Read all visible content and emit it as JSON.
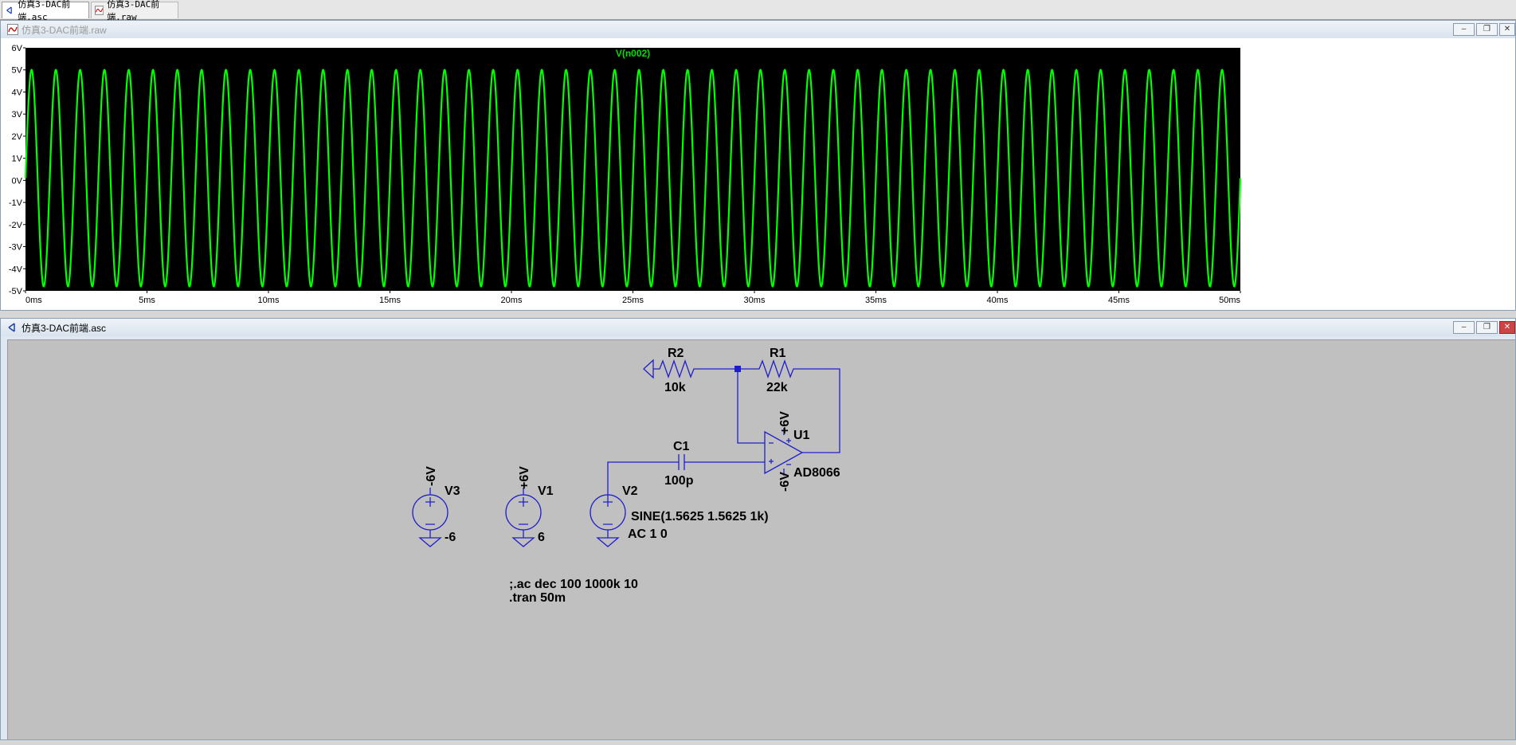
{
  "tabs": [
    {
      "label": "仿真3-DAC前端.asc",
      "icon": "schematic-icon"
    },
    {
      "label": "仿真3-DAC前端.raw",
      "icon": "waveform-icon"
    }
  ],
  "waveform_window": {
    "title": "仿真3-DAC前端.raw",
    "trace_label": "V(n002)",
    "controls": [
      "minimize",
      "restore",
      "close"
    ]
  },
  "schematic_window": {
    "title": "仿真3-DAC前端.asc",
    "controls": [
      "minimize",
      "restore",
      "close"
    ],
    "components": {
      "r2": {
        "ref": "R2",
        "value": "10k"
      },
      "r1": {
        "ref": "R1",
        "value": "22k"
      },
      "c1": {
        "ref": "C1",
        "value": "100p"
      },
      "u1": {
        "ref": "U1",
        "model": "AD8066",
        "vpos": "+6V",
        "vneg": "-6V"
      },
      "v3": {
        "ref": "V3",
        "value": "-6",
        "net": "-6V"
      },
      "v1": {
        "ref": "V1",
        "value": "6",
        "net": "+6V"
      },
      "v2": {
        "ref": "V2",
        "line1": "SINE(1.5625 1.5625 1k)",
        "line2": "AC 1 0"
      }
    },
    "directives": {
      "ac": ";.ac dec 100 1000k 10",
      "tran": ".tran 50m"
    }
  },
  "chart_data": {
    "type": "line",
    "title": "V(n002)",
    "xlabel": "",
    "ylabel": "",
    "x_unit": "ms",
    "y_unit": "V",
    "xlim": [
      0,
      50
    ],
    "ylim": [
      -5,
      6
    ],
    "x_ticks": [
      "0ms",
      "5ms",
      "10ms",
      "15ms",
      "20ms",
      "25ms",
      "30ms",
      "35ms",
      "40ms",
      "45ms",
      "50ms"
    ],
    "y_ticks": [
      "6V",
      "5V",
      "4V",
      "3V",
      "2V",
      "1V",
      "0V",
      "-1V",
      "-2V",
      "-3V",
      "-4V",
      "-5V"
    ],
    "series": [
      {
        "name": "V(n002)",
        "function": "sine",
        "frequency_khz": 1,
        "amplitude": 4.9,
        "offset": 0.1,
        "start_value": 0.1,
        "color": "#00ff00"
      }
    ],
    "background": "#000000",
    "grid": false
  }
}
